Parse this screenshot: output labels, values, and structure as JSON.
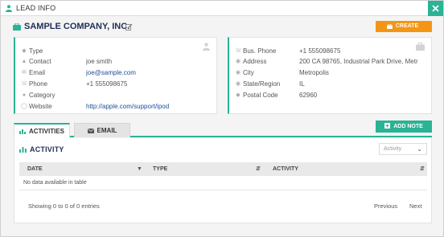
{
  "window": {
    "title": "LEAD INFO"
  },
  "company": {
    "name": "SAMPLE COMPANY, INC."
  },
  "actions": {
    "create_label": "CREATE",
    "add_note_label": "ADD NOTE"
  },
  "contact_fields": [
    {
      "label": "Type",
      "value": "",
      "icon": "tag-icon"
    },
    {
      "label": "Contact",
      "value": "joe smith",
      "icon": "person-icon"
    },
    {
      "label": "Email",
      "value": "joe@sample.com",
      "icon": "email-icon"
    },
    {
      "label": "Phone",
      "value": "+1 555098675",
      "icon": "phone-icon"
    },
    {
      "label": "Category",
      "value": "",
      "icon": "category-icon"
    },
    {
      "label": "Website",
      "value": "http://apple.com/support/ipod",
      "icon": "globe-icon"
    }
  ],
  "business_fields": [
    {
      "label": "Bus. Phone",
      "value": "+1 555098675",
      "icon": "phone-icon"
    },
    {
      "label": "Address",
      "value": "200 CA 98765, Industrial Park Drive, Metr",
      "icon": "map-marker-icon"
    },
    {
      "label": "City",
      "value": "Metropolis",
      "icon": "map-marker-icon"
    },
    {
      "label": "State/Region",
      "value": "IL",
      "icon": "map-marker-icon"
    },
    {
      "label": "Postal Code",
      "value": "62960",
      "icon": "tag-icon"
    }
  ],
  "tabs": [
    {
      "label": "ACTIVITIES",
      "active": true
    },
    {
      "label": "EMAIL",
      "active": false
    }
  ],
  "activity": {
    "title": "ACTIVITY",
    "filter_placeholder": "Activity",
    "columns": [
      "DATE",
      "TYPE",
      "ACTIVITY"
    ],
    "empty_message": "No data available in table",
    "showing": "Showing 0 to 0 of 0 entries",
    "prev_label": "Previous",
    "next_label": "Next"
  },
  "colors": {
    "accent": "#2ab394",
    "create": "#f39515",
    "heading": "#1f2f57",
    "link": "#1e4e9a"
  }
}
